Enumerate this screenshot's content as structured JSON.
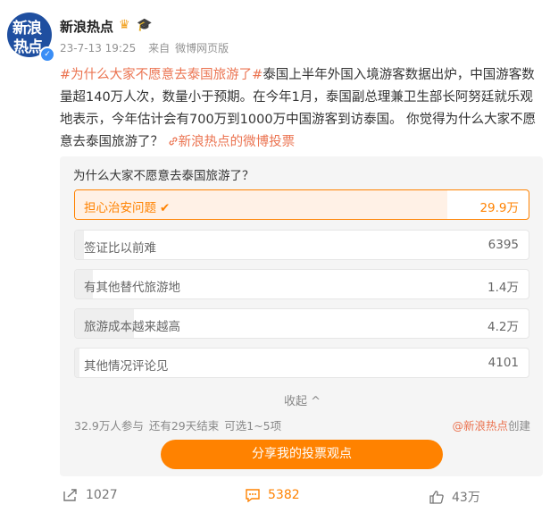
{
  "header": {
    "avatar_text_top": "新浪",
    "avatar_text_bottom": "热点",
    "username": "新浪热点",
    "timestamp": "23-7-13 19:25",
    "source": "来自",
    "source_name": "微博网页版"
  },
  "post": {
    "topic": "#为什么大家不愿意去泰国旅游了#",
    "body": "泰国上半年外国入境游客数据出炉，中国游客数量超140万人次，数量小于预期。在今年1月，泰国副总理兼卫生部长阿努廷就乐观地表示，今年估计会有700万到1000万中国游客到访泰国。 你觉得为什么大家不愿意去泰国旅游了？",
    "vote_link": "新浪热点的微博投票"
  },
  "poll": {
    "question": "为什么大家不愿意去泰国旅游了？",
    "options": [
      {
        "label": "担心治安问题",
        "value": "29.9万",
        "selected": true,
        "fraction": 0.82
      },
      {
        "label": "签证比以前难",
        "value": "6395",
        "selected": false,
        "fraction": 0.02
      },
      {
        "label": "有其他替代旅游地",
        "value": "1.4万",
        "selected": false,
        "fraction": 0.04
      },
      {
        "label": "旅游成本越来越高",
        "value": "4.2万",
        "selected": false,
        "fraction": 0.13
      },
      {
        "label": "其他情况评论见",
        "value": "4101",
        "selected": false,
        "fraction": 0.01
      }
    ],
    "collapse_label": "收起",
    "participants": "32.9万人参与",
    "remaining": "还有29天结束",
    "choice_rule": "可选1~5项",
    "creator": "@新浪热点",
    "creator_suffix": "创建",
    "share_label": "分享我的投票观点"
  },
  "footer": {
    "repost_count": "1027",
    "comment_count": "5382",
    "like_count": "43万"
  },
  "colors": {
    "accent": "#ff8200",
    "topic": "#eb7350",
    "verify": "#3a8ef6"
  }
}
